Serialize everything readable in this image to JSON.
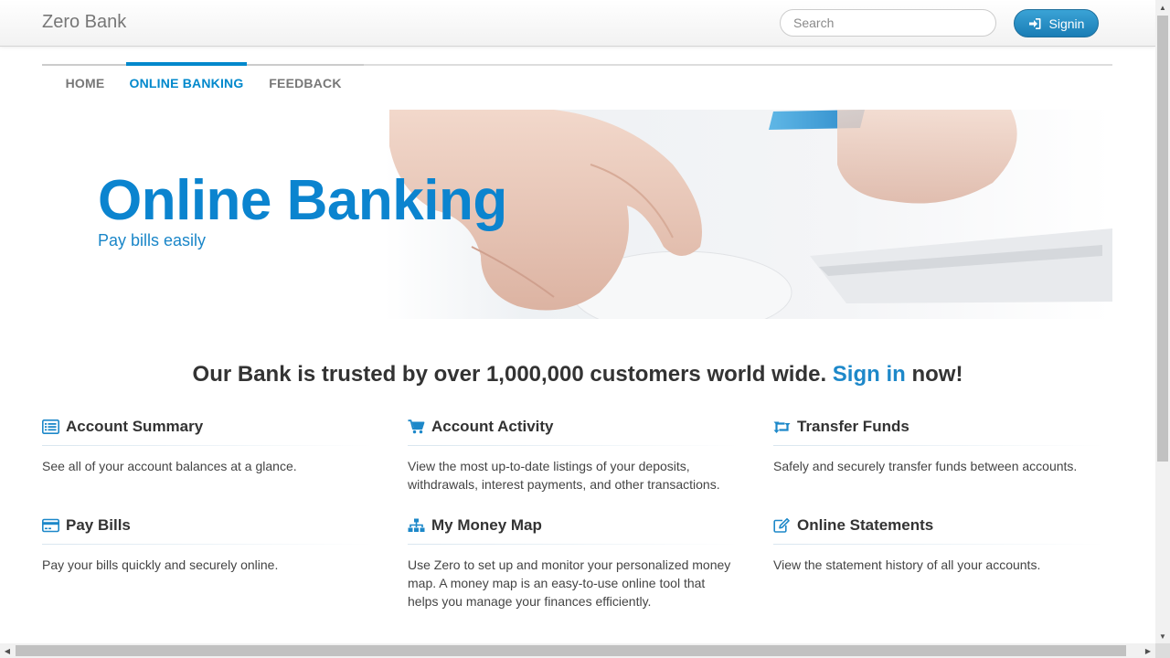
{
  "brand": "Zero Bank",
  "search": {
    "placeholder": "Search"
  },
  "signin": {
    "label": "Signin",
    "icon": "sign-in-icon"
  },
  "tabs": [
    {
      "label": "HOME",
      "active": false
    },
    {
      "label": "ONLINE BANKING",
      "active": true
    },
    {
      "label": "FEEDBACK",
      "active": false
    }
  ],
  "hero": {
    "title": "Online Banking",
    "subtitle": "Pay bills easily"
  },
  "trust": {
    "prefix": "Our Bank is trusted by over 1,000,000 customers world wide.",
    "link": "Sign in",
    "suffix": "now!"
  },
  "features": [
    {
      "title": "Account Summary",
      "icon": "list-icon",
      "description": "See all of your account balances at a glance."
    },
    {
      "title": "Account Activity",
      "icon": "cart-icon",
      "description": "View the most up-to-date listings of your deposits, withdrawals, interest payments, and other transactions."
    },
    {
      "title": "Transfer Funds",
      "icon": "retweet-icon",
      "description": "Safely and securely transfer funds between accounts."
    },
    {
      "title": "Pay Bills",
      "icon": "credit-card-icon",
      "description": "Pay your bills quickly and securely online."
    },
    {
      "title": "My Money Map",
      "icon": "sitemap-icon",
      "description": "Use Zero to set up and monitor your personalized money map. A money map is an easy-to-use online tool that helps you manage your finances efficiently."
    },
    {
      "title": "Online Statements",
      "icon": "edit-icon",
      "description": "View the statement history of all your accounts."
    }
  ],
  "colors": {
    "accent": "#0088cc",
    "hero_title": "#0b84cf",
    "button": "#1a7db5"
  }
}
